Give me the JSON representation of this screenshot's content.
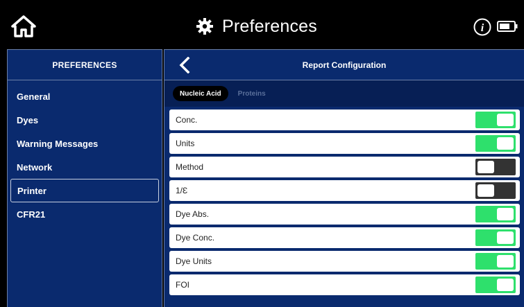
{
  "header": {
    "title": "Preferences",
    "icons": [
      "home-icon",
      "gear-icon",
      "info-icon",
      "battery-icon"
    ]
  },
  "sidebar": {
    "heading": "PREFERENCES",
    "items": [
      {
        "label": "General",
        "active": false
      },
      {
        "label": "Dyes",
        "active": false
      },
      {
        "label": "Warning Messages",
        "active": false
      },
      {
        "label": "Network",
        "active": false
      },
      {
        "label": "Printer",
        "active": true
      },
      {
        "label": "CFR21",
        "active": false
      }
    ]
  },
  "panel": {
    "title": "Report Configuration",
    "tabs": [
      {
        "label": "Nucleic Acid",
        "active": true
      },
      {
        "label": "Proteins",
        "active": false
      }
    ],
    "rows": [
      {
        "label": "Conc.",
        "enabled": true
      },
      {
        "label": "Units",
        "enabled": true
      },
      {
        "label": "Method",
        "enabled": false
      },
      {
        "label": "1/Ɛ",
        "enabled": false
      },
      {
        "label": "Dye Abs.",
        "enabled": true
      },
      {
        "label": "Dye Conc.",
        "enabled": true
      },
      {
        "label": "Dye Units",
        "enabled": true
      },
      {
        "label": "FOI",
        "enabled": true
      }
    ]
  },
  "colors": {
    "background": "#000000",
    "panel": "#0a2a6e",
    "toggle_on": "#2ee06c",
    "toggle_off": "#333333"
  }
}
